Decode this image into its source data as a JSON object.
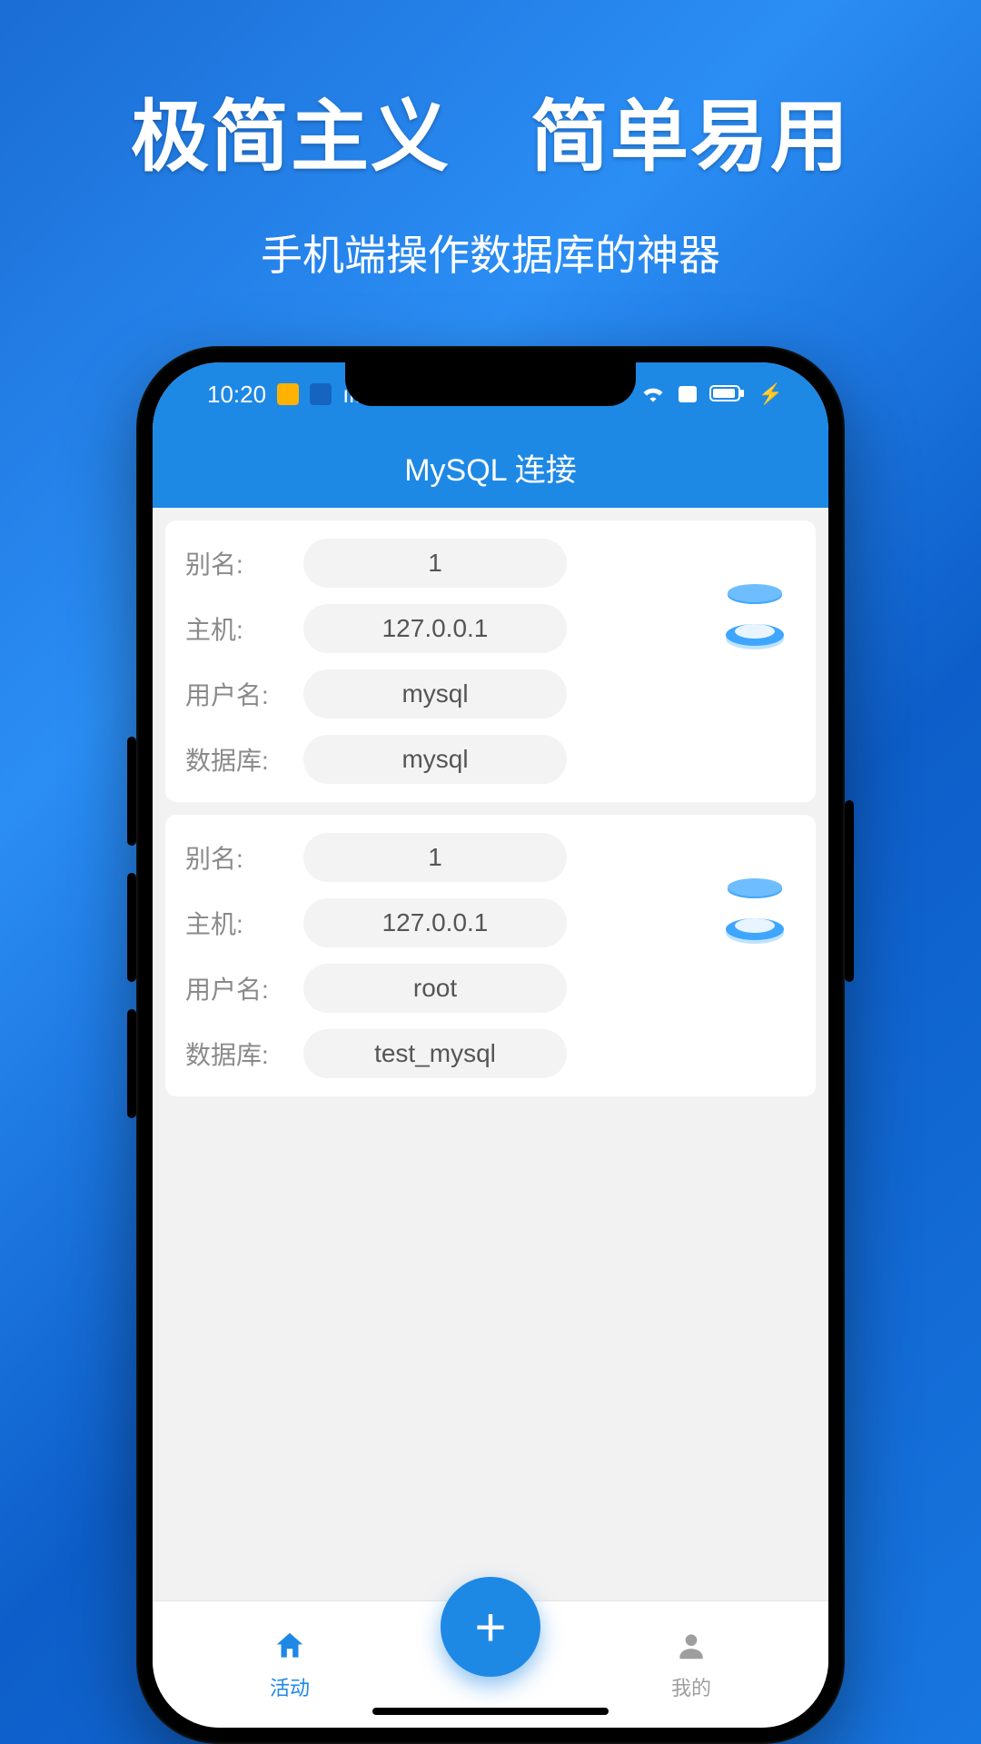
{
  "promo": {
    "headline": "极简主义　简单易用",
    "subhead": "手机端操作数据库的神器"
  },
  "statusbar": {
    "time": "10:20"
  },
  "appbar": {
    "title": "MySQL 连接"
  },
  "labels": {
    "alias": "别名:",
    "host": "主机:",
    "user": "用户名:",
    "db": "数据库:"
  },
  "connections": [
    {
      "alias": "1",
      "host": "127.0.0.1",
      "user": "mysql",
      "db": "mysql"
    },
    {
      "alias": "1",
      "host": "127.0.0.1",
      "user": "root",
      "db": "test_mysql"
    }
  ],
  "fab": {
    "glyph": "+"
  },
  "nav": {
    "home": "活动",
    "profile": "我的"
  }
}
